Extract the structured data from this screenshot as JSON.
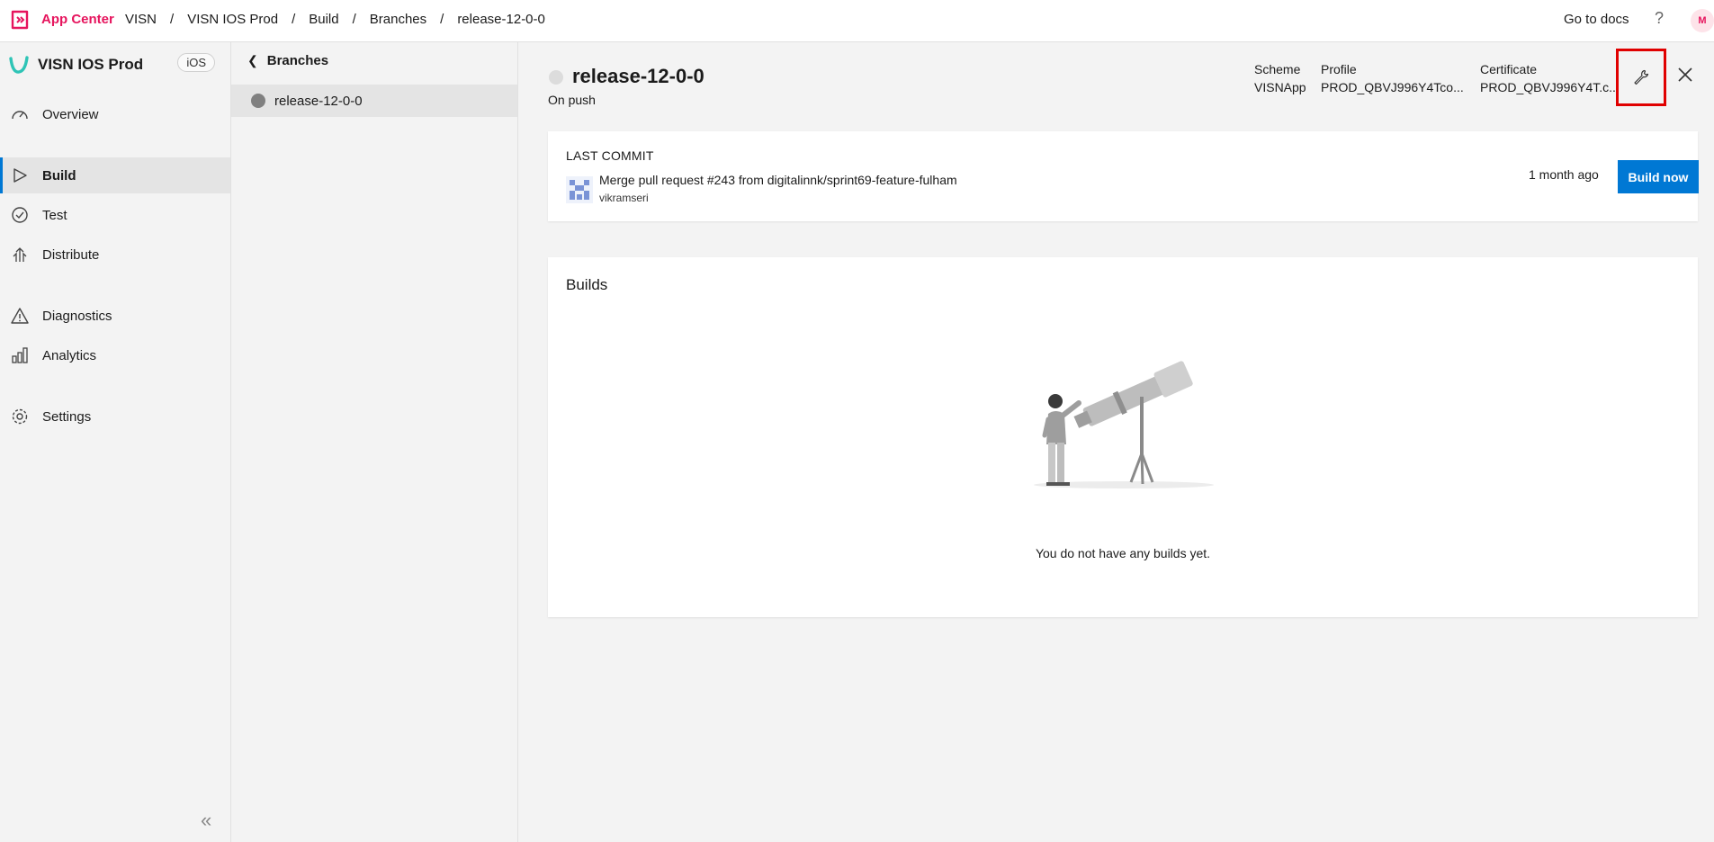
{
  "topbar": {
    "app_name": "App Center",
    "breadcrumbs": [
      "VISN",
      "VISN IOS Prod",
      "Build",
      "Branches",
      "release-12-0-0"
    ],
    "docs_label": "Go to docs",
    "help_label": "?",
    "avatar_initial": "M"
  },
  "sidebar": {
    "app_title": "VISN IOS Prod",
    "os_badge": "iOS",
    "items": [
      {
        "label": "Overview",
        "icon": "overview-icon"
      },
      {
        "label": "Build",
        "icon": "build-icon"
      },
      {
        "label": "Test",
        "icon": "test-icon"
      },
      {
        "label": "Distribute",
        "icon": "distribute-icon"
      },
      {
        "label": "Diagnostics",
        "icon": "diagnostics-icon"
      },
      {
        "label": "Analytics",
        "icon": "analytics-icon"
      },
      {
        "label": "Settings",
        "icon": "settings-icon"
      }
    ],
    "active": "Build",
    "collapse_glyph": "«"
  },
  "branches": {
    "back_label": "Branches",
    "items": [
      {
        "name": "release-12-0-0"
      }
    ]
  },
  "main": {
    "title": "release-12-0-0",
    "subtitle": "On push",
    "scheme_label": "Scheme",
    "scheme_value": "VISNApp",
    "profile_label": "Profile",
    "profile_value": "PROD_QBVJ996Y4Tco...",
    "certificate_label": "Certificate",
    "certificate_value": "PROD_QBVJ996Y4T.c...",
    "last_commit": {
      "label": "LAST COMMIT",
      "message": "Merge pull request #243 from digitalinnk/sprint69-feature-fulham",
      "author": "vikramseri",
      "time": "1 month ago",
      "build_button": "Build now"
    },
    "builds": {
      "title": "Builds",
      "empty_message": "You do not have any builds yet."
    }
  },
  "colors": {
    "brand": "#e6145d",
    "primary": "#0078d4",
    "highlight_box": "#e00000"
  }
}
